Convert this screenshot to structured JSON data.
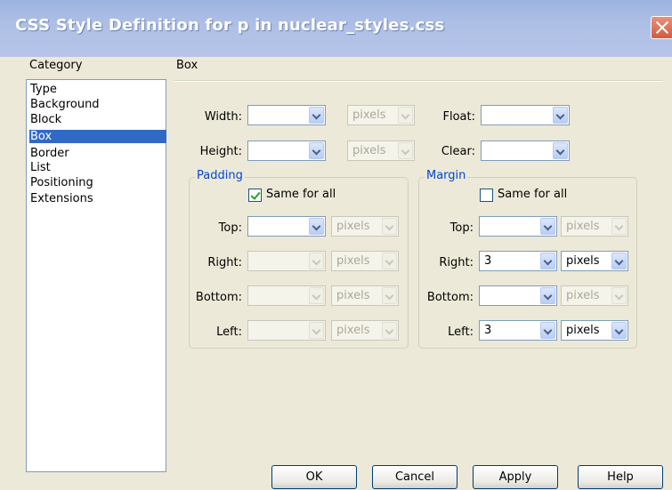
{
  "window": {
    "title": "CSS Style Definition for p in nuclear_styles.css"
  },
  "category": {
    "heading": "Category",
    "items": [
      "Type",
      "Background",
      "Block",
      "Box",
      "Border",
      "List",
      "Positioning",
      "Extensions"
    ],
    "selected": "Box"
  },
  "section": {
    "heading": "Box"
  },
  "box": {
    "width_label": "Width:",
    "width_value": "",
    "width_unit": "pixels",
    "height_label": "Height:",
    "height_value": "",
    "height_unit": "pixels",
    "float_label": "Float:",
    "float_value": "",
    "clear_label": "Clear:",
    "clear_value": ""
  },
  "padding": {
    "legend": "Padding",
    "same_label": "Same for all",
    "same_checked": true,
    "top_label": "Top:",
    "top_value": "",
    "top_unit": "pixels",
    "right_label": "Right:",
    "right_value": "",
    "right_unit": "pixels",
    "bottom_label": "Bottom:",
    "bottom_value": "",
    "bottom_unit": "pixels",
    "left_label": "Left:",
    "left_value": "",
    "left_unit": "pixels"
  },
  "margin": {
    "legend": "Margin",
    "same_label": "Same for all",
    "same_checked": false,
    "top_label": "Top:",
    "top_value": "",
    "top_unit": "pixels",
    "right_label": "Right:",
    "right_value": "3",
    "right_unit": "pixels",
    "bottom_label": "Bottom:",
    "bottom_value": "",
    "bottom_unit": "pixels",
    "left_label": "Left:",
    "left_value": "3",
    "left_unit": "pixels"
  },
  "buttons": {
    "ok": "OK",
    "cancel": "Cancel",
    "apply": "Apply",
    "help": "Help"
  }
}
